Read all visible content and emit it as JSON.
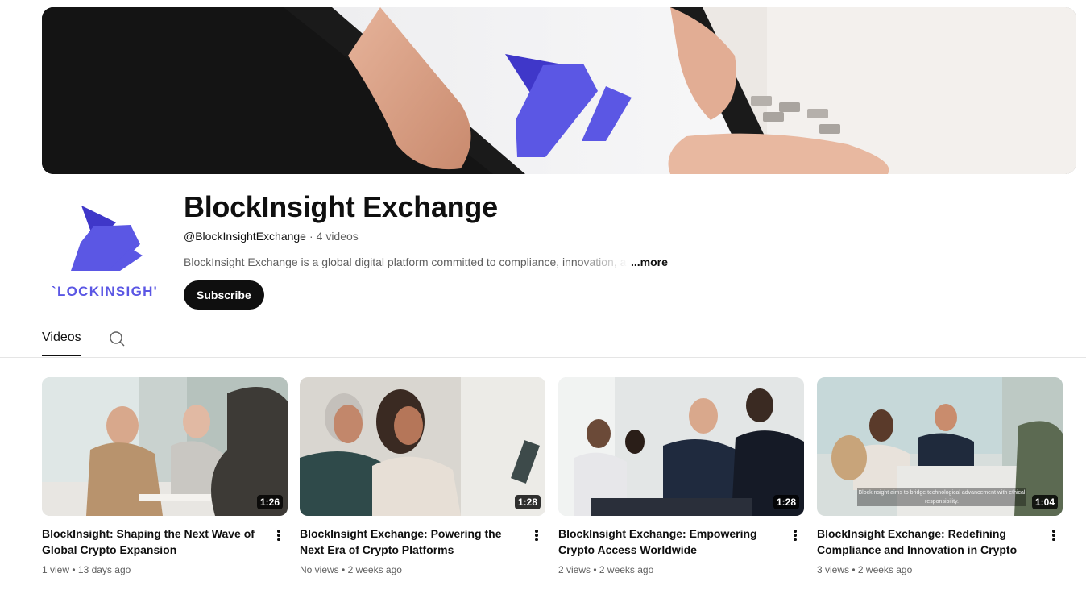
{
  "channel": {
    "name": "BlockInsight Exchange",
    "handle": "@BlockInsightExchange",
    "separator": "·",
    "video_count": "4 videos",
    "description": "BlockInsight Exchange is a global digital platform committed to compliance, innovation, a",
    "more_label": "...more",
    "subscribe_label": "Subscribe",
    "logo_text": "`LOCKINSIGH'",
    "brand_color": "#5b57e4"
  },
  "tabs": {
    "videos_label": "Videos",
    "search_icon": "search-icon"
  },
  "videos": [
    {
      "title": "BlockInsight: Shaping the Next Wave of Global Crypto Expansion",
      "views": "1 view",
      "age": "13 days ago",
      "duration": "1:26",
      "caption": ""
    },
    {
      "title": "BlockInsight Exchange: Powering the Next Era of Crypto Platforms",
      "views": "No views",
      "age": "2 weeks ago",
      "duration": "1:28",
      "caption": ""
    },
    {
      "title": "BlockInsight Exchange: Empowering Crypto Access Worldwide",
      "views": "2 views",
      "age": "2 weeks ago",
      "duration": "1:28",
      "caption": ""
    },
    {
      "title": "BlockInsight Exchange: Redefining Compliance and Innovation in Crypto",
      "views": "3 views",
      "age": "2 weeks ago",
      "duration": "1:04",
      "caption": "BlockInsight aims to bridge technological advancement with ethical responsibility."
    }
  ],
  "meta_separator": "•"
}
